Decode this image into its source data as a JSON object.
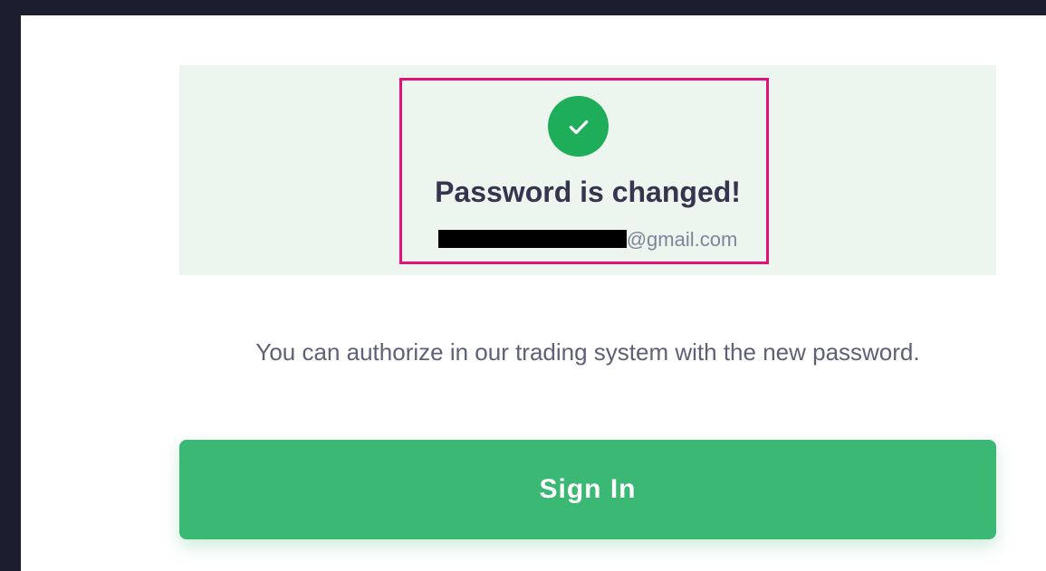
{
  "status": {
    "title": "Password is changed!",
    "email_suffix": "@gmail.com",
    "icon": "check-icon",
    "accent_color": "#1ead58",
    "highlight_color": "#e5117b"
  },
  "message": "You can authorize in our trading system with the new password.",
  "sign_in_button": {
    "label": "Sign In",
    "color": "#3bb874"
  }
}
